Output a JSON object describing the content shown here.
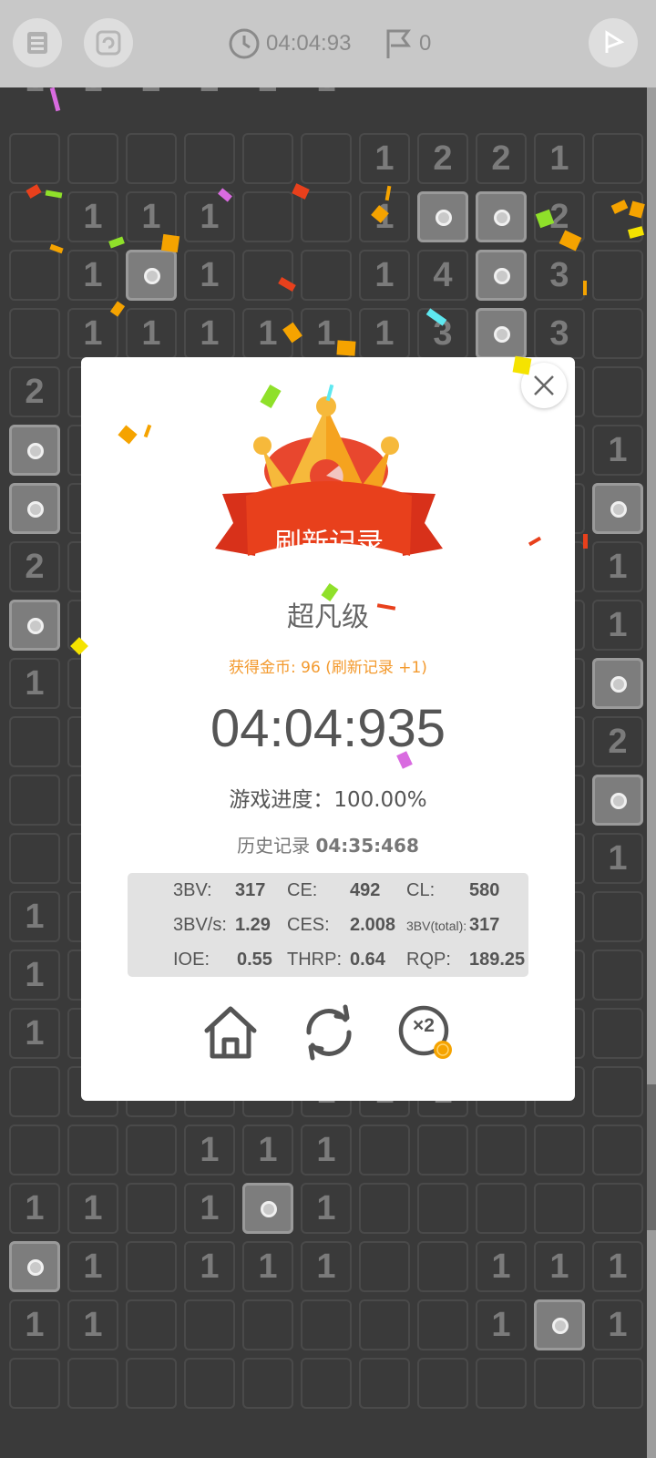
{
  "topbar": {
    "timer": "04:04:93",
    "flags": "0"
  },
  "board": {
    "top_row": [
      "1",
      "1",
      "2",
      "2",
      "2",
      "1"
    ],
    "rows": [
      {
        "r": 0,
        "cells": [
          [
            6,
            "1"
          ],
          [
            7,
            "2"
          ],
          [
            8,
            "2"
          ],
          [
            9,
            "1"
          ]
        ]
      },
      {
        "r": 1,
        "cells": [
          [
            1,
            "1"
          ],
          [
            2,
            "1"
          ],
          [
            3,
            "1"
          ],
          [
            6,
            "1"
          ],
          [
            7,
            "M"
          ],
          [
            8,
            "M"
          ],
          [
            9,
            "2"
          ]
        ]
      },
      {
        "r": 2,
        "cells": [
          [
            1,
            "1"
          ],
          [
            2,
            "M"
          ],
          [
            3,
            "1"
          ],
          [
            6,
            "1"
          ],
          [
            7,
            "4"
          ],
          [
            8,
            "M"
          ],
          [
            9,
            "3"
          ]
        ]
      },
      {
        "r": 3,
        "cells": [
          [
            1,
            "1"
          ],
          [
            2,
            "1"
          ],
          [
            3,
            "1"
          ],
          [
            4,
            "1"
          ],
          [
            5,
            "1"
          ],
          [
            6,
            "1"
          ],
          [
            7,
            "3"
          ],
          [
            8,
            "M"
          ],
          [
            9,
            "3"
          ]
        ]
      },
      {
        "r": 4,
        "cells": [
          [
            0,
            "2"
          ]
        ]
      },
      {
        "r": 5,
        "cells": [
          [
            0,
            "M"
          ],
          [
            10,
            "1"
          ]
        ]
      },
      {
        "r": 6,
        "cells": [
          [
            0,
            "M"
          ],
          [
            10,
            "M"
          ]
        ]
      },
      {
        "r": 7,
        "cells": [
          [
            0,
            "2"
          ],
          [
            10,
            "1"
          ]
        ]
      },
      {
        "r": 8,
        "cells": [
          [
            0,
            "M"
          ],
          [
            10,
            "1"
          ]
        ]
      },
      {
        "r": 9,
        "cells": [
          [
            0,
            "1"
          ],
          [
            10,
            "M"
          ]
        ]
      },
      {
        "r": 10,
        "cells": [
          [
            10,
            "2"
          ]
        ]
      },
      {
        "r": 11,
        "cells": [
          [
            10,
            "M"
          ]
        ]
      },
      {
        "r": 12,
        "cells": [
          [
            10,
            "1"
          ]
        ]
      },
      {
        "r": 13,
        "cells": [
          [
            0,
            "1"
          ]
        ]
      },
      {
        "r": 14,
        "cells": [
          [
            0,
            "1"
          ]
        ]
      },
      {
        "r": 15,
        "cells": [
          [
            0,
            "1"
          ]
        ]
      },
      {
        "r": 16,
        "cells": [
          [
            5,
            "1"
          ],
          [
            6,
            "1"
          ],
          [
            7,
            "1"
          ]
        ]
      },
      {
        "r": 17,
        "cells": [
          [
            3,
            "1"
          ],
          [
            4,
            "1"
          ],
          [
            5,
            "1"
          ]
        ]
      },
      {
        "r": 18,
        "cells": [
          [
            0,
            "1"
          ],
          [
            1,
            "1"
          ],
          [
            3,
            "1"
          ],
          [
            4,
            "M"
          ],
          [
            5,
            "1"
          ]
        ]
      },
      {
        "r": 19,
        "cells": [
          [
            0,
            "M"
          ],
          [
            1,
            "1"
          ],
          [
            3,
            "1"
          ],
          [
            4,
            "1"
          ],
          [
            5,
            "1"
          ],
          [
            8,
            "1"
          ],
          [
            9,
            "1"
          ],
          [
            10,
            "1"
          ]
        ]
      },
      {
        "r": 20,
        "cells": [
          [
            0,
            "1"
          ],
          [
            1,
            "1"
          ],
          [
            8,
            "1"
          ],
          [
            9,
            "M"
          ],
          [
            10,
            "1"
          ]
        ]
      }
    ]
  },
  "dialog": {
    "ribbon": "刷新记录",
    "difficulty": "超凡级",
    "coins": "获得金币: 96 (刷新记录 +1)",
    "time": "04:04:935",
    "progress": "游戏进度：100.00%",
    "history_label": "历史记录",
    "history_value": "04:35:468",
    "stats": {
      "bbbv_label": "3BV:",
      "bbbv_value": "317",
      "ce_label": "CE:",
      "ce_value": "492",
      "cl_label": "CL:",
      "cl_value": "580",
      "bbbvs_label": "3BV/s:",
      "bbbvs_value": "1.29",
      "ces_label": "CES:",
      "ces_value": "2.008",
      "bbbvt_label": "3BV(total):",
      "bbbvt_value": "317",
      "ioe_label": "IOE:",
      "ioe_value": "0.55",
      "thrp_label": "THRP:",
      "thrp_value": "0.64",
      "rqp_label": "RQP:",
      "rqp_value": "189.25"
    },
    "multiplier_label": "×2"
  },
  "colors": {
    "accent_orange": "#f39a2e",
    "ribbon_red": "#e74c1c",
    "crown_gold": "#f6b93b"
  }
}
